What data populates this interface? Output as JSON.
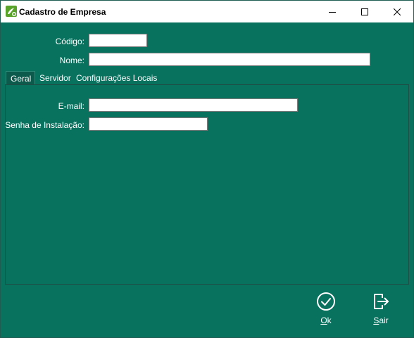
{
  "window": {
    "title": "Cadastro de Empresa",
    "icon": "app-leaf-icon"
  },
  "form": {
    "codigo_label": "Código:",
    "codigo_value": "",
    "nome_label": "Nome:",
    "nome_value": ""
  },
  "tabs": [
    {
      "label": "Geral",
      "active": true
    },
    {
      "label": "Servidor",
      "active": false
    },
    {
      "label": "Configurações Locais",
      "active": false
    }
  ],
  "geral": {
    "email_label": "E-mail:",
    "email_value": "",
    "senha_label": "Senha de Instalação:",
    "senha_value": ""
  },
  "actions": {
    "ok_first": "O",
    "ok_rest": "k",
    "sair_first": "S",
    "sair_rest": "air"
  },
  "colors": {
    "background": "#08725f",
    "titlebar": "#ffffff",
    "accent": "#4caf50"
  }
}
